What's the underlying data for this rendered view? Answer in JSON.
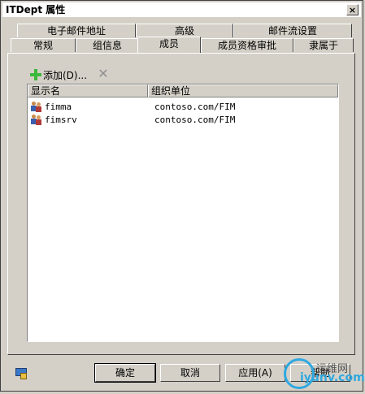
{
  "window": {
    "title": "ITDept 属性",
    "close_glyph": "×"
  },
  "tabs": {
    "row_back": [
      {
        "label": "电子邮件地址"
      },
      {
        "label": "高级"
      },
      {
        "label": "邮件流设置"
      }
    ],
    "row_front": [
      {
        "label": "常规"
      },
      {
        "label": "组信息"
      },
      {
        "label": "成员",
        "active": true
      },
      {
        "label": "成员资格审批"
      },
      {
        "label": "隶属于"
      }
    ]
  },
  "toolbar": {
    "add_label": "添加(D)...",
    "add_icon": "plus-icon",
    "delete_icon": "delete-icon",
    "delete_glyph": "✕"
  },
  "members_list": {
    "columns": [
      "显示名",
      "组织单位"
    ],
    "rows": [
      {
        "name": "fimma",
        "unit": "contoso.com/FIM"
      },
      {
        "name": "fimsrv",
        "unit": "contoso.com/FIM"
      }
    ]
  },
  "buttons": {
    "ok": "确定",
    "cancel": "取消",
    "apply": "应用(A)",
    "help": "帮助"
  },
  "watermark": {
    "cn": "运维网",
    "en": "iyunv.com"
  },
  "colors": {
    "face": "#d4d0c8",
    "plus_green": "#3cb83c",
    "watermark_blue": "#2ea8e0"
  }
}
